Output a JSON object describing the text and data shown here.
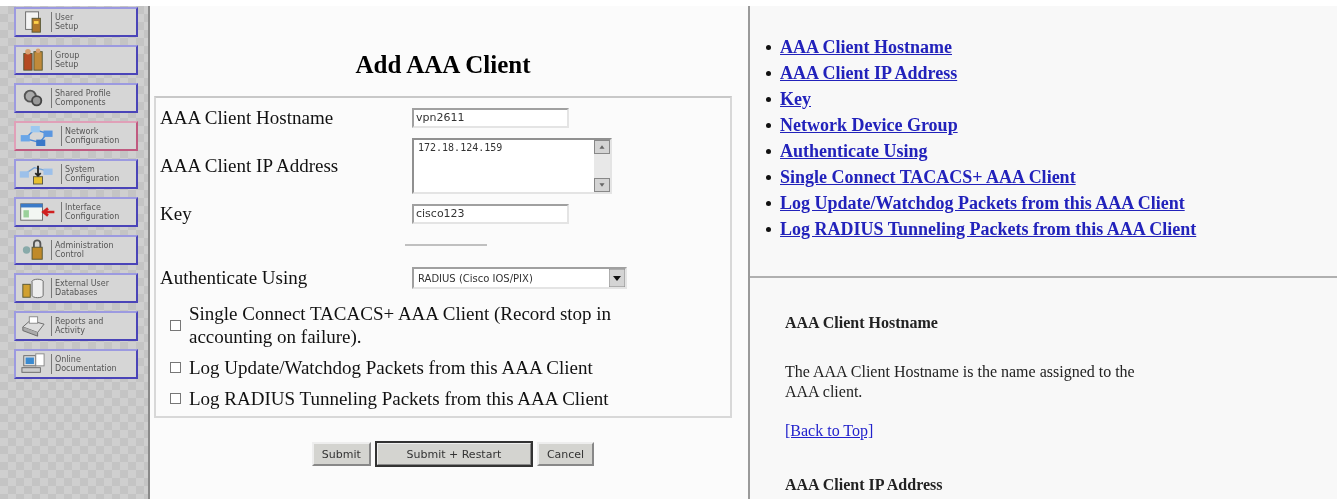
{
  "sidebar": {
    "items": [
      {
        "label": "User\nSetup",
        "selected": false
      },
      {
        "label": "Group\nSetup",
        "selected": false
      },
      {
        "label": "Shared Profile\nComponents",
        "selected": false
      },
      {
        "label": "Network\nConfiguration",
        "selected": true
      },
      {
        "label": "System\nConfiguration",
        "selected": false
      },
      {
        "label": "Interface\nConfiguration",
        "selected": false
      },
      {
        "label": "Administration\nControl",
        "selected": false
      },
      {
        "label": "External User\nDatabases",
        "selected": false
      },
      {
        "label": "Reports and\nActivity",
        "selected": false
      },
      {
        "label": "Online\nDocumentation",
        "selected": false
      }
    ]
  },
  "form": {
    "title": "Add AAA Client",
    "fields": [
      {
        "kind": "text",
        "label": "AAA Client Hostname",
        "value": "vpn2611"
      },
      {
        "kind": "textarea",
        "label": "AAA Client IP Address",
        "value": "172.18.124.159"
      },
      {
        "kind": "text",
        "label": "Key",
        "value": "cisco123"
      },
      {
        "kind": "rule"
      },
      {
        "kind": "select",
        "label": "Authenticate Using",
        "value": "RADIUS (Cisco IOS/PIX)"
      }
    ],
    "checkboxes": [
      {
        "label": "Single Connect TACACS+ AAA Client (Record stop in accounting on failure).",
        "checked": false
      },
      {
        "label": "Log Update/Watchdog Packets from this AAA Client",
        "checked": false
      },
      {
        "label": "Log RADIUS Tunneling Packets from this AAA Client",
        "checked": false
      }
    ],
    "buttons": [
      {
        "label": "Submit",
        "default": false
      },
      {
        "label": "Submit + Restart",
        "default": true
      },
      {
        "label": "Cancel",
        "default": false
      }
    ]
  },
  "help": {
    "links": [
      "AAA Client Hostname",
      "AAA Client IP Address",
      "Key",
      "Network Device Group",
      "Authenticate Using",
      "Single Connect TACACS+ AAA Client",
      "Log Update/Watchdog Packets from this AAA Client",
      "Log RADIUS Tunneling Packets from this AAA Client"
    ],
    "sections": [
      {
        "heading": "AAA Client Hostname",
        "text": "The AAA Client Hostname is the name assigned to the AAA client.",
        "back_link": "[Back to Top]"
      },
      {
        "heading": "AAA Client IP Address"
      }
    ]
  }
}
